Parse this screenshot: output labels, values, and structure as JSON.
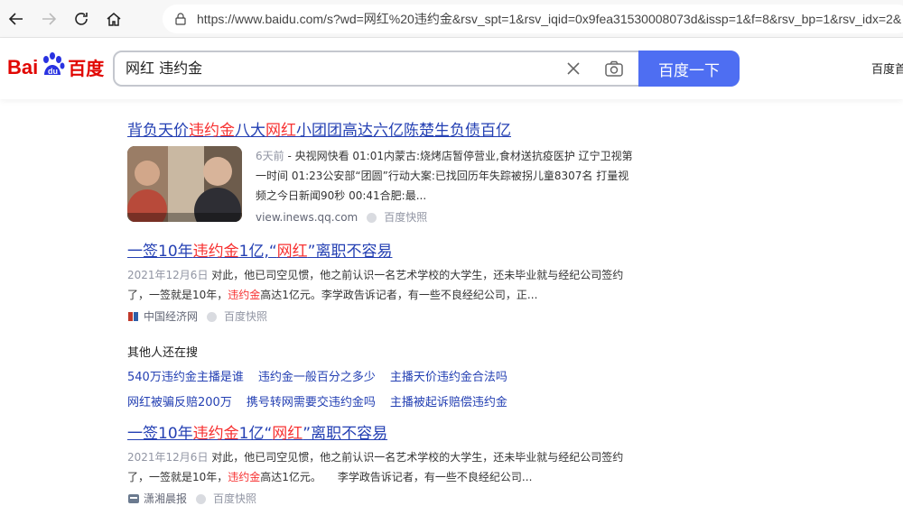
{
  "browser": {
    "url": "https://www.baidu.com/s?wd=网红%20违约金&rsv_spt=1&rsv_iqid=0x9fea31530008073d&issp=1&f=8&rsv_bp=1&rsv_idx=2&"
  },
  "header": {
    "logo_bai": "Bai",
    "logo_du": "du",
    "logo_cn": "百度",
    "query": "网红 违约金",
    "search_button": "百度一下",
    "top_link": "百度首"
  },
  "results": [
    {
      "title_parts": [
        "背负天价",
        "违约金",
        "八大",
        "网红",
        "小团团高达六亿陈楚生负债百亿"
      ],
      "time": "6天前",
      "snippet": " - 央视网快看 01:01内蒙古:烧烤店暂停营业,食材送抗疫医护 辽宁卫视第一时间 01:23公安部“团圆”行动大案:已找回历年失踪被拐儿童8307名 打量视频之今日新闻90秒 00:41合肥:最...",
      "source": "view.inews.qq.com",
      "snapshot": "百度快照"
    },
    {
      "title_parts": [
        "一签10年",
        "违约金",
        "1亿,“",
        "网红",
        "”离职不容易"
      ],
      "date": "2021年12月6日",
      "snippet_a": " 对此，他已司空见惯，他之前认识一名艺术学校的大学生，还未毕业就与经纪公司签约了，一签就是10年，",
      "snippet_em": "违约金",
      "snippet_b": "高达1亿元。李学政告诉记者，有一些不良经纪公司，正...",
      "source": "中国经济网",
      "snapshot": "百度快照"
    },
    {
      "title_parts": [
        "一签10年",
        "违约金",
        "1亿“",
        "网红",
        "”离职不容易"
      ],
      "date": "2021年12月6日",
      "snippet_a": " 对此，他已司空见惯，他之前认识一名艺术学校的大学生，还未毕业就与经纪公司签约了，一签就是10年，",
      "snippet_em": "违约金",
      "snippet_b": "高达1亿元。　　李学政告诉记者，有一些不良经纪公司...",
      "source": "潇湘晨报",
      "snapshot": "百度快照"
    }
  ],
  "also_search": {
    "title": "其他人还在搜",
    "row1": [
      "540万违约金主播是谁",
      "违约金一般百分之多少",
      "主播天价违约金合法吗"
    ],
    "row2": [
      "网红被骗反赔200万",
      "携号转网需要交违约金吗",
      "主播被起诉赔偿违约金"
    ]
  },
  "colors": {
    "link": "#2440b3",
    "highlight": "#f73131",
    "button": "#4e6ef2",
    "logo": "#e10602"
  }
}
